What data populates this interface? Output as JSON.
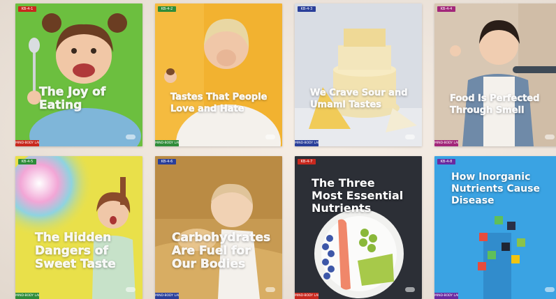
{
  "cards": [
    {
      "title": "The Joy of\nEating",
      "tag": "KB-4-1",
      "footer": "MIND-BODY LAB",
      "colors": {
        "bg": "#6cbf3f",
        "tag": "#c8281e",
        "footer": "#c8281e"
      }
    },
    {
      "title": "Tastes That People\nLove and Hate",
      "tag": "KB-4-2",
      "footer": "MIND-BODY LAB",
      "colors": {
        "bg": "#f2b230",
        "tag": "#2f8c3a",
        "footer": "#2f8c3a"
      }
    },
    {
      "title": "We Crave Sour and\nUmami Tastes",
      "tag": "KB-4-3",
      "footer": "MIND-BODY LAB",
      "colors": {
        "bg": "#d9dde4",
        "tag": "#2a3f9a",
        "footer": "#2a3f9a"
      }
    },
    {
      "title": "Food Is Perfected\nThrough Smell",
      "tag": "KB-4-4",
      "footer": "MIND-BODY LAB",
      "colors": {
        "bg": "#d8c7b3",
        "tag": "#a2267a",
        "footer": "#a2267a"
      }
    },
    {
      "title": "The Hidden\nDangers of\nSweet Taste",
      "tag": "KB-4-5",
      "footer": "MIND-BODY LAB",
      "colors": {
        "bg": "#e9e04a",
        "tag": "#2f8c3a",
        "footer": "#2f8c3a"
      }
    },
    {
      "title": "Carbohydrates\nAre Fuel for\nOur Bodies",
      "tag": "KB-4-6",
      "footer": "MIND-BODY LAB",
      "colors": {
        "bg": "#c79a52",
        "tag": "#2a3f9a",
        "footer": "#2a3f9a"
      }
    },
    {
      "title": "The Three\nMost Essential\nNutrients",
      "tag": "KB-4-7",
      "footer": "MIND-BODY LAB",
      "colors": {
        "bg": "#2c2f36",
        "tag": "#c8281e",
        "footer": "#c8281e"
      }
    },
    {
      "title": "How Inorganic\nNutrients Cause\nDisease",
      "tag": "KB-4-8",
      "footer": "MIND-BODY LAB",
      "colors": {
        "bg": "#3aa3e3",
        "tag": "#6a2aa0",
        "footer": "#6a2aa0"
      }
    }
  ]
}
